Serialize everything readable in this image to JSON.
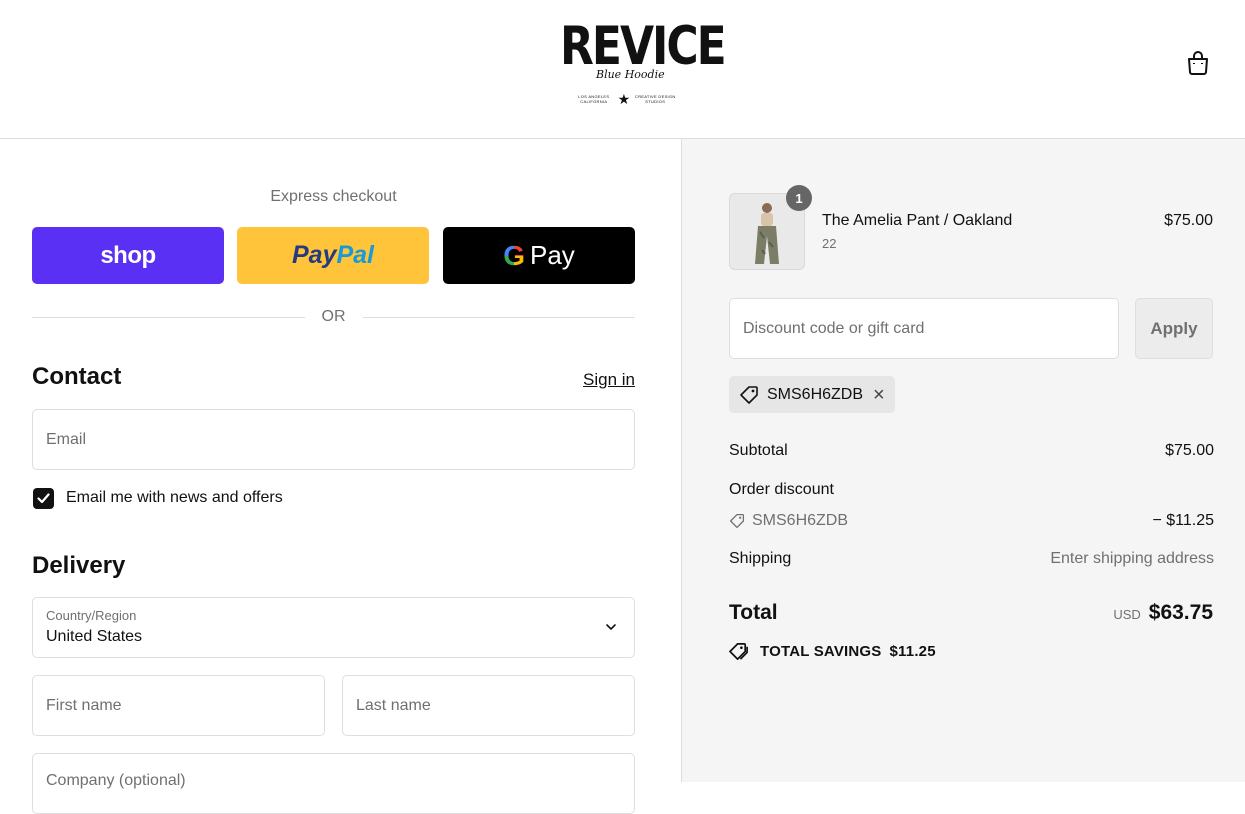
{
  "header": {
    "logo_text": "REVICE",
    "logo_script": "Blue Hoodie",
    "logo_sub_left": "LOS ANGELES CALIFORNIA",
    "logo_sub_right": "CREATIVE DESIGN STUDIOS"
  },
  "express": {
    "title": "Express checkout",
    "shop_label": "shop",
    "paypal_part1": "Pay",
    "paypal_part2": "Pal",
    "gpay_g": "G",
    "gpay_label": "Pay",
    "or_text": "OR"
  },
  "contact": {
    "title": "Contact",
    "signin_label": "Sign in",
    "email_placeholder": "Email",
    "newsletter_label": "Email me with news and offers",
    "newsletter_checked": true
  },
  "delivery": {
    "title": "Delivery",
    "country_label": "Country/Region",
    "country_value": "United States",
    "first_name_placeholder": "First name",
    "last_name_placeholder": "Last name",
    "company_placeholder": "Company (optional)"
  },
  "order": {
    "item": {
      "quantity": "1",
      "name": "The Amelia Pant / Oakland",
      "variant": "22",
      "price": "$75.00"
    },
    "discount_placeholder": "Discount code or gift card",
    "apply_label": "Apply",
    "applied_code": "SMS6H6ZDB",
    "subtotal_label": "Subtotal",
    "subtotal_value": "$75.00",
    "order_discount_label": "Order discount",
    "discount_code": "SMS6H6ZDB",
    "discount_value": "− $11.25",
    "shipping_label": "Shipping",
    "shipping_value": "Enter shipping address",
    "total_label": "Total",
    "total_currency": "USD",
    "total_value": "$63.75",
    "savings_label": "TOTAL SAVINGS",
    "savings_value": "$11.25"
  },
  "colors": {
    "shop_purple": "#5a31f4",
    "paypal_yellow": "#ffc439",
    "gpay_black": "#000000",
    "summary_bg": "#f5f5f5"
  }
}
